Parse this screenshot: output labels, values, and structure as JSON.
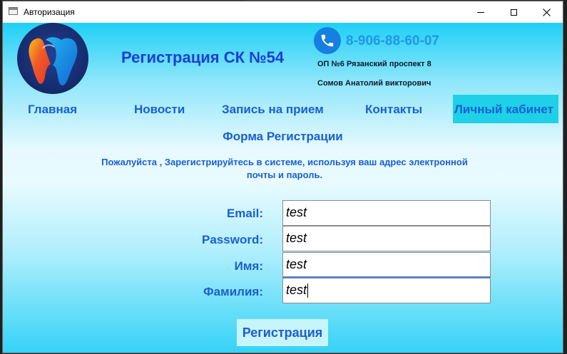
{
  "window": {
    "title": "Авторизация"
  },
  "header": {
    "site_title": "Регистрация СК №54",
    "phone": "8-906-88-60-07",
    "address": "ОП №6 Рязанский проспект 8",
    "owner": "Сомов Анатолий викторович"
  },
  "nav": {
    "items": [
      {
        "label": "Главная"
      },
      {
        "label": "Новости"
      },
      {
        "label": "Запись на прием"
      },
      {
        "label": "Контакты"
      },
      {
        "label": "Личный кабинет",
        "active": true
      }
    ]
  },
  "form": {
    "title": "Форма Регистрации",
    "subtitle_line1": "Пожалуйста , Зарегистрируйтесь в системе, используя ваш адрес электронной",
    "subtitle_line2": "почты и пароль.",
    "fields": [
      {
        "label": "Email:",
        "value": "test"
      },
      {
        "label": "Password:",
        "value": "test"
      },
      {
        "label": "Имя:",
        "value": "test"
      },
      {
        "label": "Фамилия:",
        "value": "test"
      }
    ],
    "submit_label": "Регистрация"
  },
  "colors": {
    "accent_text": "#1a5fd0",
    "title_text": "#1a3fd6",
    "phone_text": "#2196e8",
    "active_tab": "#1ed0e8",
    "gradient_top": "#1ed0f6",
    "gradient_bottom": "#35d3f7"
  },
  "icons": {
    "logo": "tooth-logo-icon",
    "phone": "phone-icon",
    "app": "window-app-icon"
  }
}
